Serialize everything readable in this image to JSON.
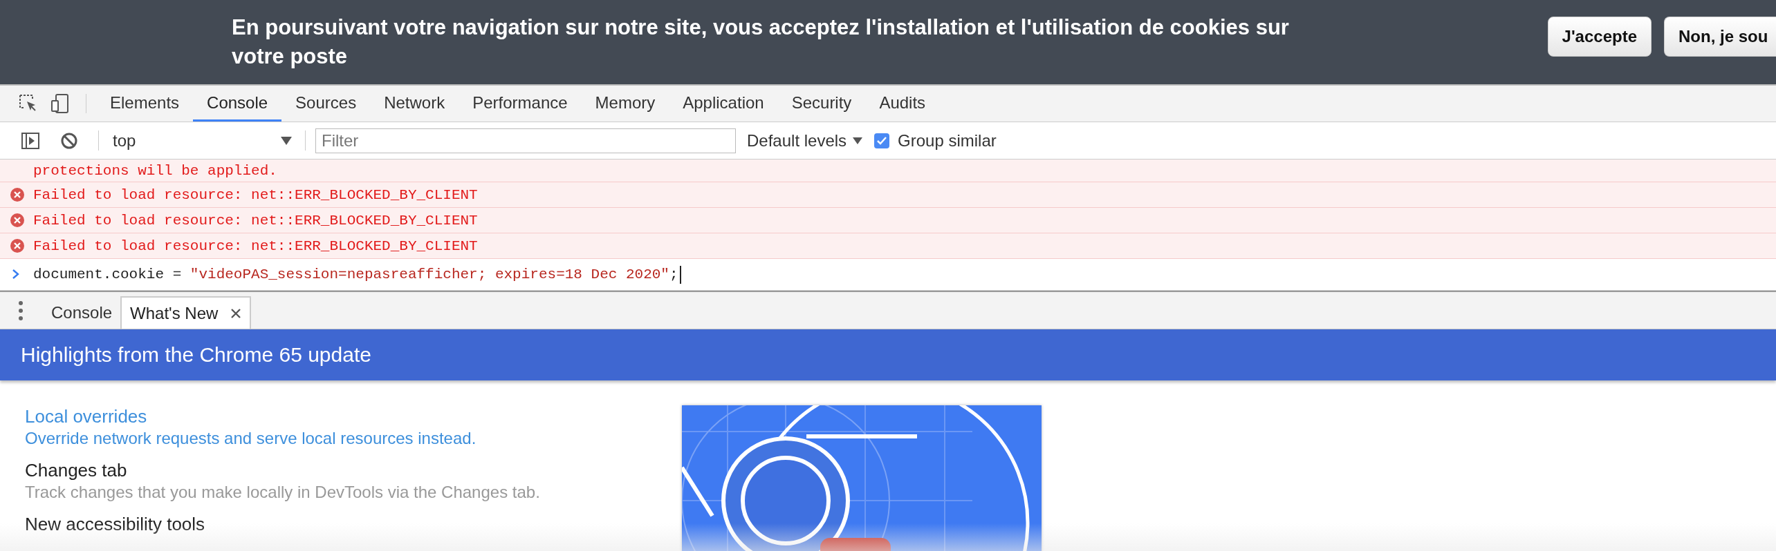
{
  "banner": {
    "message": "En poursuivant votre navigation sur notre site, vous acceptez l'installation et l'utilisation de cookies sur votre poste",
    "buttons": [
      "J'accepte",
      "Non, je sou"
    ]
  },
  "devtools": {
    "tabs": [
      {
        "label": "Elements",
        "selected": false
      },
      {
        "label": "Console",
        "selected": true
      },
      {
        "label": "Sources",
        "selected": false
      },
      {
        "label": "Network",
        "selected": false
      },
      {
        "label": "Performance",
        "selected": false
      },
      {
        "label": "Memory",
        "selected": false
      },
      {
        "label": "Application",
        "selected": false
      },
      {
        "label": "Security",
        "selected": false
      },
      {
        "label": "Audits",
        "selected": false
      }
    ],
    "console_toolbar": {
      "context": "top",
      "filter_placeholder": "Filter",
      "levels": "Default levels",
      "group_similar": {
        "label": "Group similar",
        "checked": true
      }
    },
    "messages": [
      {
        "kind": "continuation",
        "text": "protections will be applied."
      },
      {
        "kind": "error",
        "text": "Failed to load resource: net::ERR_BLOCKED_BY_CLIENT"
      },
      {
        "kind": "error",
        "text": "Failed to load resource: net::ERR_BLOCKED_BY_CLIENT"
      },
      {
        "kind": "error",
        "text": "Failed to load resource: net::ERR_BLOCKED_BY_CLIENT"
      }
    ],
    "prompt": {
      "code": "document.cookie",
      "operator": " = ",
      "string": "\"videoPAS_session=nepasreafficher; expires=18 Dec 2020\"",
      "end": ";"
    },
    "drawer": {
      "tabs": [
        {
          "label": "Console",
          "selected": false,
          "closable": false
        },
        {
          "label": "What's New",
          "selected": true,
          "closable": true
        }
      ],
      "header": "Highlights from the Chrome 65 update",
      "items": [
        {
          "title": "Local overrides",
          "description": "Override network requests and serve local resources instead.",
          "selected": true
        },
        {
          "title": "Changes tab",
          "description": "Track changes that you make locally in DevTools via the Changes tab.",
          "selected": false
        },
        {
          "title": "New accessibility tools",
          "selected": false
        }
      ]
    }
  }
}
